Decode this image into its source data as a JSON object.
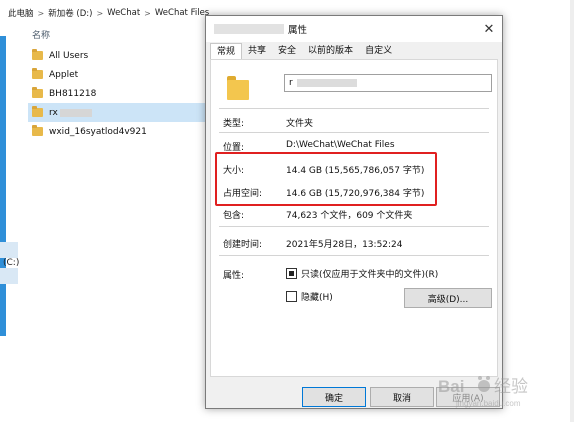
{
  "breadcrumb": {
    "items": [
      "此电脑",
      "新加卷 (D:)",
      "WeChat",
      "WeChat Files"
    ],
    "separator": ">"
  },
  "file_list": {
    "column_header": "名称",
    "items": [
      {
        "name": "All Users",
        "selected": false
      },
      {
        "name": "Applet",
        "selected": false
      },
      {
        "name": "BH811218",
        "selected": false
      },
      {
        "name": "rx",
        "selected": true
      },
      {
        "name": "wxid_16syatlod4v921",
        "selected": false
      }
    ]
  },
  "left_nav": {
    "drive_label": "(C:)"
  },
  "dialog": {
    "title_suffix": "属性",
    "close_icon": "close-icon",
    "tabs": [
      "常规",
      "共享",
      "安全",
      "以前的版本",
      "自定义"
    ],
    "active_tab": "常规",
    "name_value": "r",
    "fields": {
      "type_label": "类型:",
      "type_value": "文件夹",
      "location_label": "位置:",
      "location_value": "D:\\WeChat\\WeChat Files",
      "size_label": "大小:",
      "size_value": "14.4 GB (15,565,786,057 字节)",
      "size_on_disk_label": "占用空间:",
      "size_on_disk_value": "14.6 GB (15,720,976,384 字节)",
      "contains_label": "包含:",
      "contains_value": "74,623 个文件，609 个文件夹",
      "created_label": "创建时间:",
      "created_value": "2021年5月28日，13:52:24",
      "attributes_label": "属性:"
    },
    "attributes": {
      "readonly_label": "只读(仅应用于文件夹中的文件)(R)",
      "readonly_state": "indeterminate",
      "hidden_label": "隐藏(H)",
      "hidden_state": "unchecked",
      "advanced_button": "高级(D)..."
    },
    "buttons": {
      "ok": "确定",
      "cancel": "取消",
      "apply": "应用(A)"
    }
  },
  "watermark": {
    "text": "Baidu 经验",
    "url_text": "jingyan.baidu.com"
  },
  "colors": {
    "highlight": "#e02020",
    "selection": "#cce4f7",
    "folder": "#f3c64e",
    "accent": "#0078d7"
  }
}
